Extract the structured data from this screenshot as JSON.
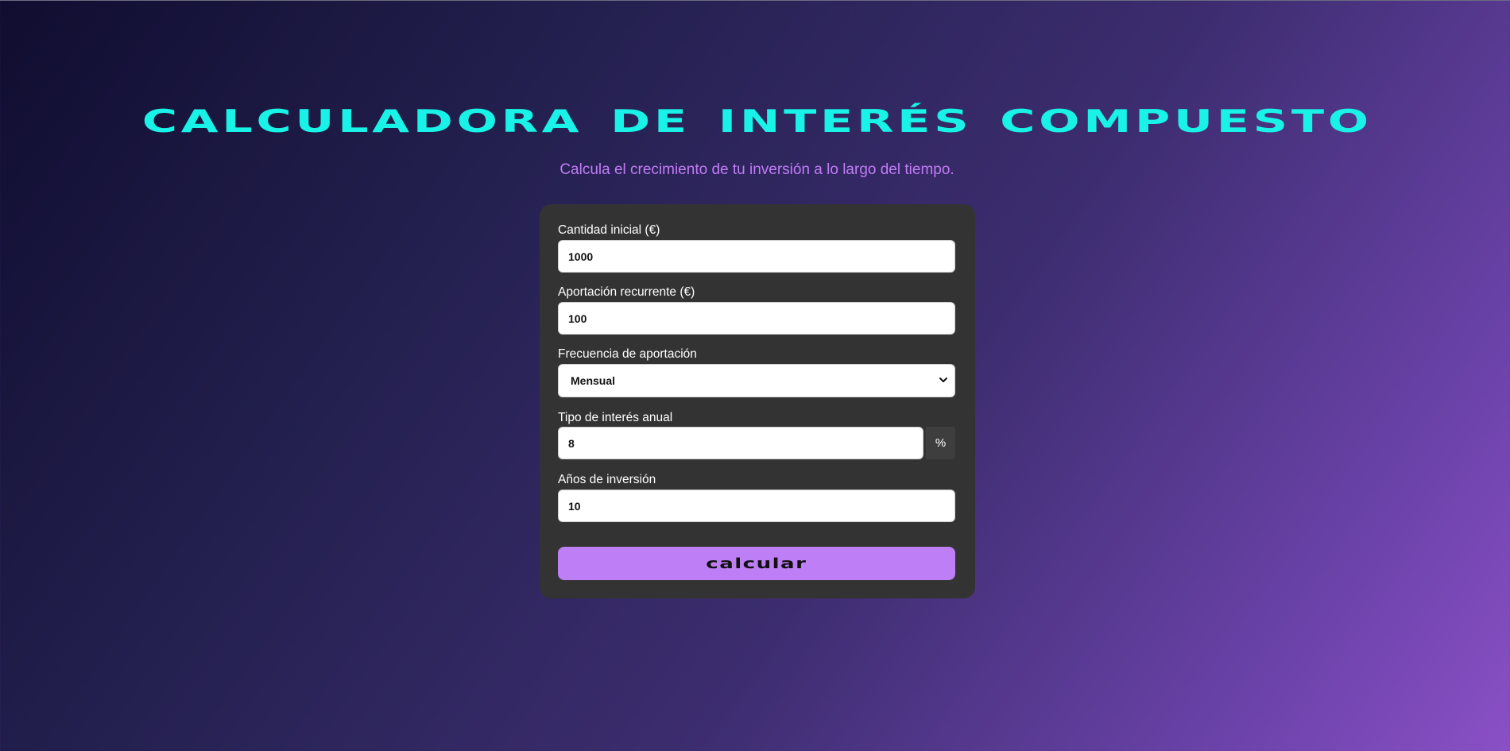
{
  "page": {
    "title": "Calculadora de Interés Compuesto",
    "subtitle": "Calcula el crecimiento de tu inversión a lo largo del tiempo."
  },
  "form": {
    "initial_amount": {
      "label": "Cantidad inicial (€)",
      "value": "1000"
    },
    "recurring_contribution": {
      "label": "Aportación recurrente (€)",
      "value": "100"
    },
    "frequency": {
      "label": "Frecuencia de aportación",
      "selected": "Mensual"
    },
    "annual_rate": {
      "label": "Tipo de interés anual",
      "value": "8",
      "unit": "%"
    },
    "years": {
      "label": "Años de inversión",
      "value": "10"
    },
    "submit_label": "calcular"
  },
  "colors": {
    "title": "#19f2e6",
    "subtitle": "#c17cf5",
    "card": "#343334",
    "button": "#be7ef5"
  },
  "icons": {
    "select_caret": "chevron-down-icon"
  }
}
